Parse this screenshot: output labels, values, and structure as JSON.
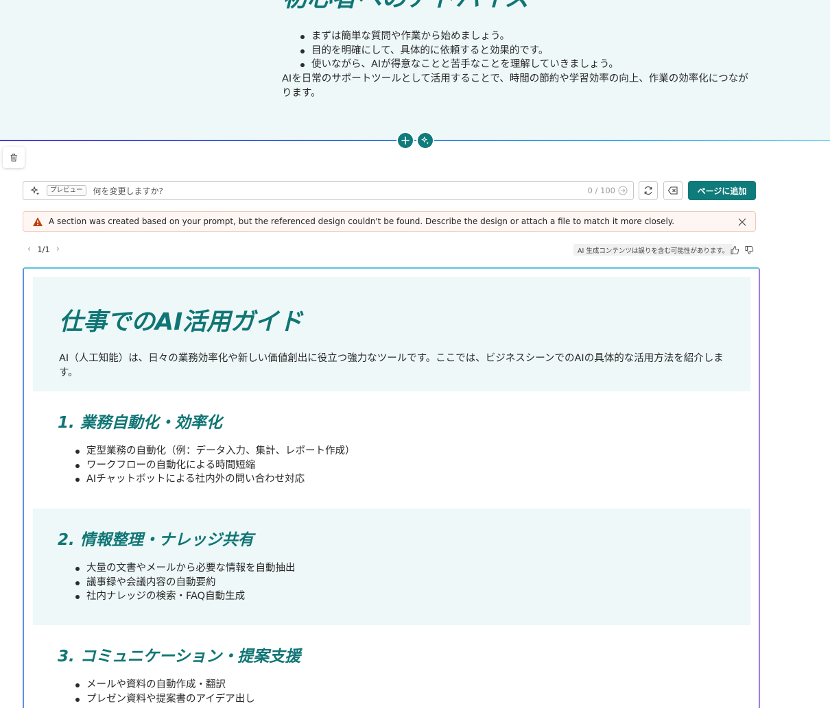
{
  "top_section": {
    "title": "初心者へのアドバイス",
    "bullets": [
      "まずは簡単な質問や作業から始めましょう。",
      "目的を明確にして、具体的に依頼すると効果的です。",
      "使いながら、AIが得意なことと苦手なことを理解していきましょう。"
    ],
    "paragraph": "AIを日常のサポートツールとして活用することで、時間の節約や学習効率の向上、作業の効率化につながります。"
  },
  "toolbar": {
    "preview_badge": "プレビュー",
    "prompt_placeholder": "何を変更しますか?",
    "counter": "0 / 100",
    "add_to_page": "ページに追加"
  },
  "warning": {
    "message": "A section was created based on your prompt, but the referenced design couldn't be found. Describe the design or attach a file to match it more closely."
  },
  "pager": {
    "label": "1/1"
  },
  "disclaimer": "AI 生成コンテンツは誤りを含む可能性があります。",
  "preview": {
    "title": "仕事でのAI活用ガイド",
    "description": "AI（人工知能）は、日々の業務効率化や新しい価値創出に役立つ強力なツールです。ここでは、ビジネスシーンでのAIの具体的な活用方法を紹介します。",
    "sections": [
      {
        "title": "1. 業務自動化・効率化",
        "items": [
          "定型業務の自動化（例：データ入力、集計、レポート作成）",
          "ワークフローの自動化による時間短縮",
          "AIチャットボットによる社内外の問い合わせ対応"
        ]
      },
      {
        "title": "2. 情報整理・ナレッジ共有",
        "items": [
          "大量の文書やメールから必要な情報を自動抽出",
          "議事録や会議内容の自動要約",
          "社内ナレッジの検索・FAQ自動生成"
        ]
      },
      {
        "title": "3. コミュニケーション・提案支援",
        "items": [
          "メールや資料の自動作成・翻訳",
          "プレゼン資料や提案書のアイデア出し"
        ]
      }
    ]
  },
  "colors": {
    "accent": "#0f7b7b",
    "heading": "#107575",
    "section_tint": "#eef8f8",
    "warning_icon": "#c13e0a"
  },
  "icons": {
    "add": "plus-icon",
    "ai": "sparkle-icon",
    "delete": "trash-icon",
    "refresh": "refresh-icon",
    "clear": "backspace-icon",
    "warning": "warning-icon",
    "close": "close-icon",
    "like": "thumbs-up-icon",
    "dislike": "thumbs-down-icon"
  }
}
